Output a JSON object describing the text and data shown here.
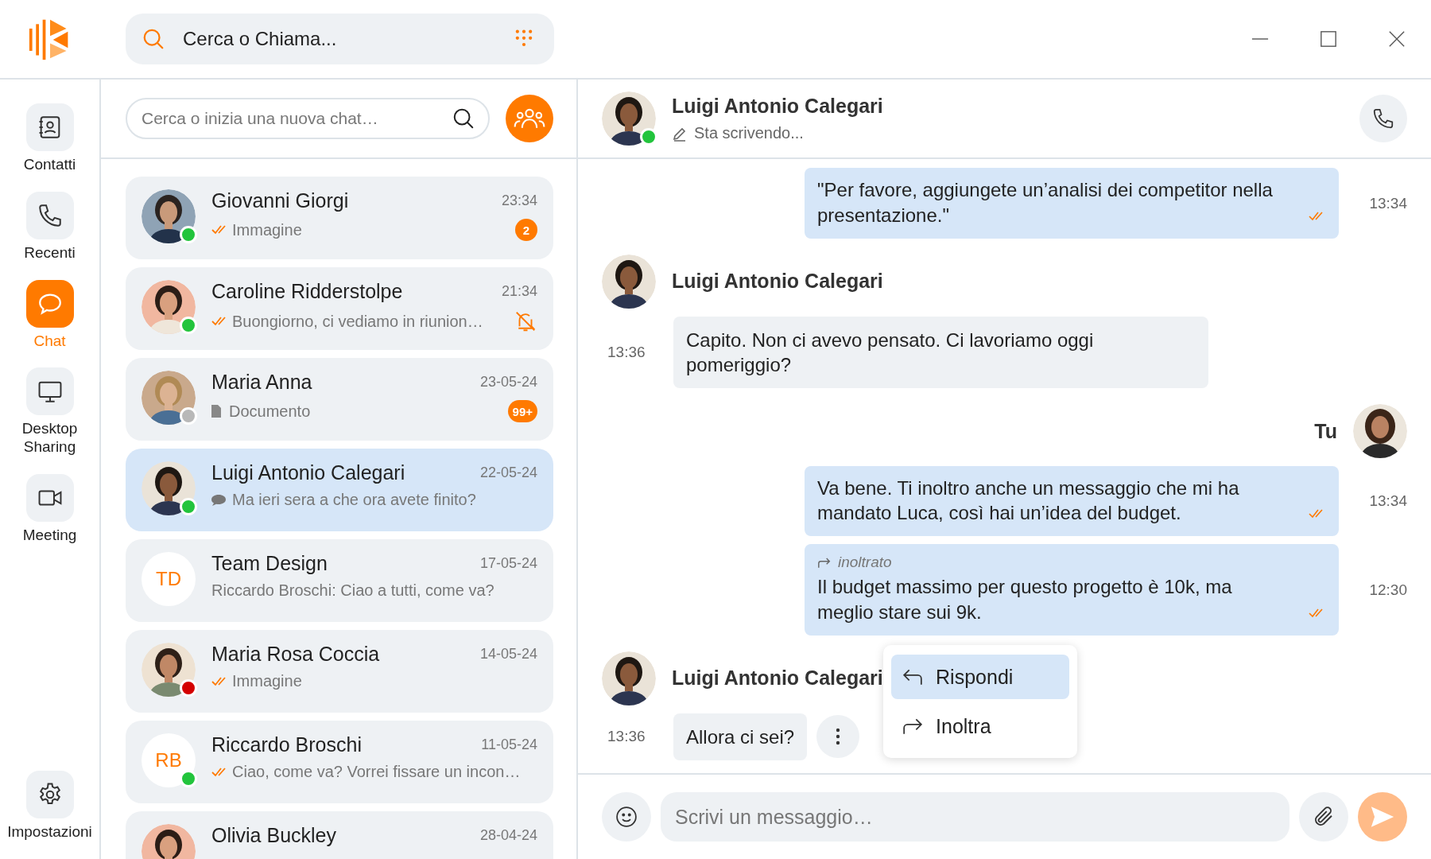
{
  "top_bar": {
    "search": {
      "placeholder": "Cerca o Chiama..."
    }
  },
  "nav": {
    "items": [
      {
        "label": "Contatti",
        "selected": false
      },
      {
        "label": "Recenti",
        "selected": false
      },
      {
        "label": "Chat",
        "selected": true
      },
      {
        "label": "Desktop Sharing",
        "selected": false
      },
      {
        "label": "Meeting",
        "selected": false
      }
    ],
    "footer": {
      "label": "Impostazioni",
      "selected": false
    }
  },
  "chat_list": {
    "search": {
      "placeholder": "Cerca o inizia una nuova chat…"
    },
    "items": [
      {
        "name": "Giovanni Giorgi",
        "time": "23:34",
        "kind": "sent",
        "preview": "Immagine",
        "color": "#22c43c",
        "badge": "2",
        "muted": false,
        "selected": false
      },
      {
        "name": "Caroline Ridderstolpe",
        "time": "21:34",
        "kind": "sent",
        "preview": "Buongiorno, ci vediamo in riunion…",
        "color": "#22c43c",
        "muted": true,
        "selected": false
      },
      {
        "name": "Maria Anna",
        "time": "23-05-24",
        "kind": "document",
        "preview": "Documento",
        "color": "#b8b8b8",
        "badge": "99+",
        "muted": false,
        "selected": false
      },
      {
        "name": "Luigi Antonio Calegari",
        "time": "22-05-24",
        "kind": "received",
        "preview": "Ma ieri sera a che ora avete finito?",
        "color": "#22c43c",
        "muted": false,
        "selected": true
      },
      {
        "name": "Team Design",
        "time": "17-05-24",
        "kind": "group",
        "preview": "Riccardo Broschi: Ciao a tutti, come va?",
        "initials": "TD",
        "muted": false,
        "selected": false
      },
      {
        "name": "Maria Rosa Coccia",
        "time": "14-05-24",
        "kind": "sent",
        "preview": "Immagine",
        "color": "#d40000",
        "muted": false,
        "selected": false
      },
      {
        "name": "Riccardo Broschi",
        "time": "11-05-24",
        "kind": "sent",
        "preview": "Ciao, come va? Vorrei fissare un incon…",
        "initials": "RB",
        "color": "#22c43c",
        "muted": false,
        "selected": false
      },
      {
        "name": "Olivia Buckley",
        "time": "28-04-24",
        "selected": false
      }
    ]
  },
  "chat": {
    "contact": {
      "name": "Luigi Antonio Calegari",
      "status": "Sta scrivendo...",
      "color": "#22c43c"
    },
    "messages": [
      {
        "kind": "out",
        "text": "\"Per favore, aggiungete un’analisi dei competitor nella presentazione.\"",
        "time": "13:34",
        "read": true
      },
      {
        "kind": "sender",
        "name": "Luigi Antonio Calegari"
      },
      {
        "kind": "in",
        "text": "Capito. Non ci avevo pensato. Ci lavoriamo oggi pomeriggio?",
        "time": "13:36"
      },
      {
        "kind": "self",
        "name": "Tu"
      },
      {
        "kind": "out",
        "text": "Va bene. Ti inoltro anche un messaggio che mi ha mandato Luca, così hai un’idea del budget.",
        "time": "13:34",
        "read": true
      },
      {
        "kind": "out",
        "forwarded": "inoltrato",
        "text": "Il budget massimo per questo progetto è 10k, ma meglio stare sui 9k.",
        "time": "12:30",
        "read": true
      },
      {
        "kind": "sender",
        "name": "Luigi Antonio Calegari"
      },
      {
        "kind": "in",
        "text": "Allora ci sei?",
        "time": "13:36",
        "menu_open": true
      }
    ],
    "menu": [
      {
        "label": "Rispondi",
        "selected": true
      },
      {
        "label": "Inoltra",
        "selected": false
      }
    ],
    "composer": {
      "placeholder": "Scrivi un messaggio…"
    }
  }
}
